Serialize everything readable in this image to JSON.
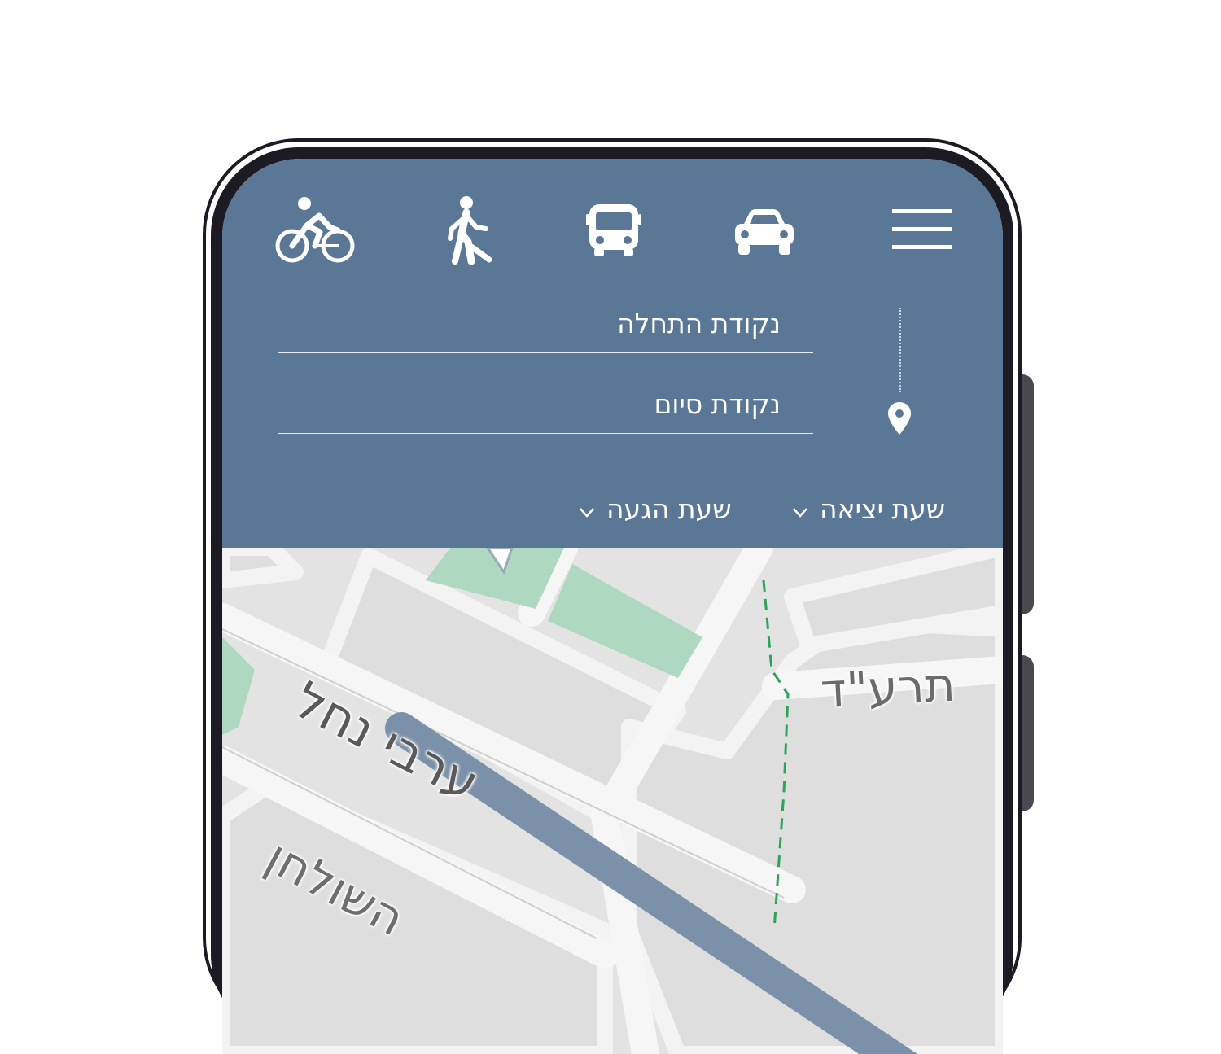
{
  "header": {
    "bg_color": "#5b7796",
    "modes": [
      {
        "name": "bicycle",
        "icon": "bicycle-icon"
      },
      {
        "name": "walk",
        "icon": "walk-icon"
      },
      {
        "name": "bus",
        "icon": "bus-icon"
      },
      {
        "name": "car",
        "icon": "car-icon"
      }
    ],
    "menu_icon": "hamburger-menu-icon"
  },
  "route_form": {
    "start_placeholder": "נקודת התחלה",
    "end_placeholder": "נקודת סיום",
    "marker_icon": "location-pin-icon"
  },
  "time_options": {
    "departure_label": "שעת יציאה",
    "arrival_label": "שעת הגעה",
    "dropdown_icon": "chevron-down-icon"
  },
  "map": {
    "streets": {
      "street_1": "ערבי נחל",
      "street_2": "תרע\"ד",
      "street_3": "השולחן"
    },
    "route_color": "#7b90a9",
    "walk_path_color": "#2fa35a",
    "park_color": "#aed8c0"
  }
}
